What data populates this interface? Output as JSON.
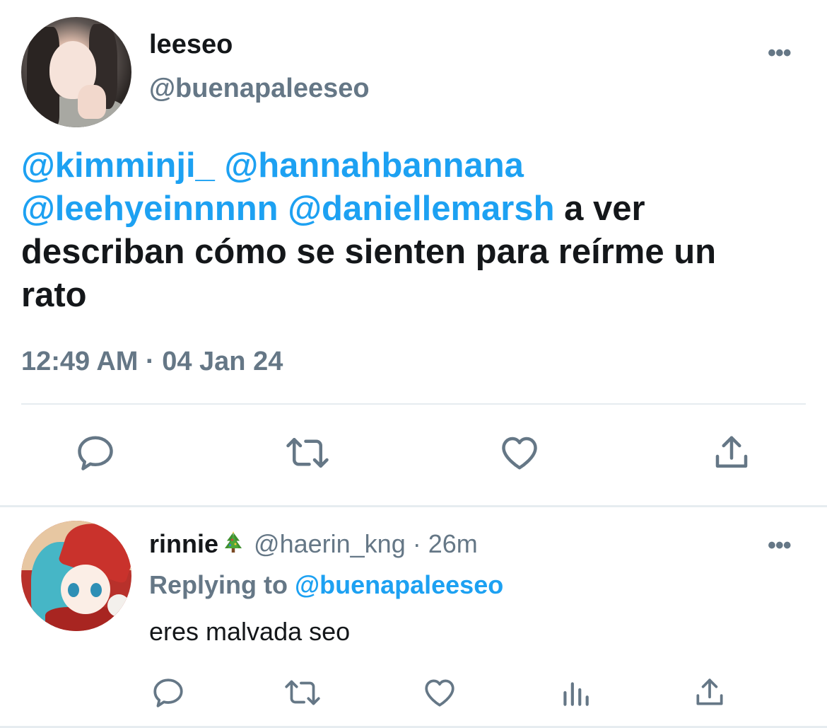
{
  "main_tweet": {
    "display_name": "leeseo",
    "handle": "@buenapaleeseo",
    "more_label": "•••",
    "text_lines": [
      [
        {
          "text": "@kimminji_",
          "mention": true
        },
        {
          "text": " ",
          "mention": false
        },
        {
          "text": "@hannahbannana",
          "mention": true
        }
      ],
      [
        {
          "text": "@leehyeinnnnn",
          "mention": true
        },
        {
          "text": " ",
          "mention": false
        },
        {
          "text": "@daniellemarsh",
          "mention": true
        },
        {
          "text": " a ver",
          "mention": false
        }
      ],
      [
        {
          "text": "describan cómo se sienten para reírme un",
          "mention": false
        }
      ],
      [
        {
          "text": "rato",
          "mention": false
        }
      ]
    ],
    "timestamp": "12:49 AM · 04 Jan 24",
    "actions": [
      "reply-icon",
      "retweet-icon",
      "like-icon",
      "share-icon"
    ]
  },
  "reply": {
    "display_name": "rinnie",
    "emoji": "christmas-tree-icon",
    "handle": "@haerin_kng",
    "separator": " · ",
    "time": "26m",
    "more_label": "•••",
    "replying_prefix": "Replying to ",
    "replying_to": "@buenapaleeseo",
    "text": "eres malvada seo",
    "actions": [
      "reply-icon",
      "retweet-icon",
      "like-icon",
      "analytics-icon",
      "share-icon"
    ]
  },
  "colors": {
    "text": "#14171a",
    "secondary": "#657786",
    "accent": "#1da1f2",
    "divider": "#e6ecf0"
  }
}
